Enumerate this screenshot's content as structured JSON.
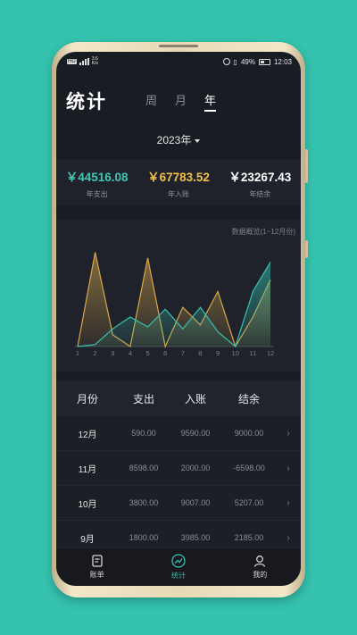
{
  "status_bar": {
    "network": "HD",
    "speed": "3.6\nK/s",
    "battery_pct": "49%",
    "time": "12:03"
  },
  "header": {
    "title": "统计",
    "tabs": [
      "周",
      "月",
      "年"
    ],
    "active_tab": 2
  },
  "year_selector": {
    "value": "2023年"
  },
  "summary": [
    {
      "value": "￥44516.08",
      "label": "年支出",
      "color": "#3fc7b4"
    },
    {
      "value": "￥67783.52",
      "label": "年入账",
      "color": "#f0c04a"
    },
    {
      "value": "￥23267.43",
      "label": "年结余",
      "color": "#e8e8e8"
    }
  ],
  "overview_label": "数据概览(1~12月份)",
  "chart_data": {
    "type": "area",
    "categories": [
      "1",
      "2",
      "3",
      "4",
      "5",
      "6",
      "7",
      "8",
      "9",
      "10",
      "11",
      "12"
    ],
    "series": [
      {
        "color": "#d7a84a",
        "values": [
          0,
          9590,
          1200,
          0,
          9007,
          0,
          3985,
          2200,
          5600,
          0,
          3000,
          6800
        ]
      },
      {
        "color": "#35c2ae",
        "values": [
          0,
          200,
          1800,
          3000,
          2000,
          3800,
          1800,
          3985,
          1500,
          0,
          5600,
          8598
        ]
      }
    ],
    "ylim": [
      0,
      10000
    ]
  },
  "table": {
    "headers": [
      "月份",
      "支出",
      "入账",
      "结余"
    ],
    "rows": [
      {
        "month": "12月",
        "expense": "590.00",
        "income": "9590.00",
        "balance": "9000.00"
      },
      {
        "month": "11月",
        "expense": "8598.00",
        "income": "2000.00",
        "balance": "-6598.00"
      },
      {
        "month": "10月",
        "expense": "3800.00",
        "income": "9007.00",
        "balance": "5207.00"
      },
      {
        "month": "9月",
        "expense": "1800.00",
        "income": "3985.00",
        "balance": "2185.00"
      }
    ],
    "arrow": "›"
  },
  "bottom_nav": [
    {
      "label": "账单",
      "icon": "bill-icon"
    },
    {
      "label": "统计",
      "icon": "chart-icon",
      "active": true
    },
    {
      "label": "我的",
      "icon": "profile-icon"
    }
  ]
}
